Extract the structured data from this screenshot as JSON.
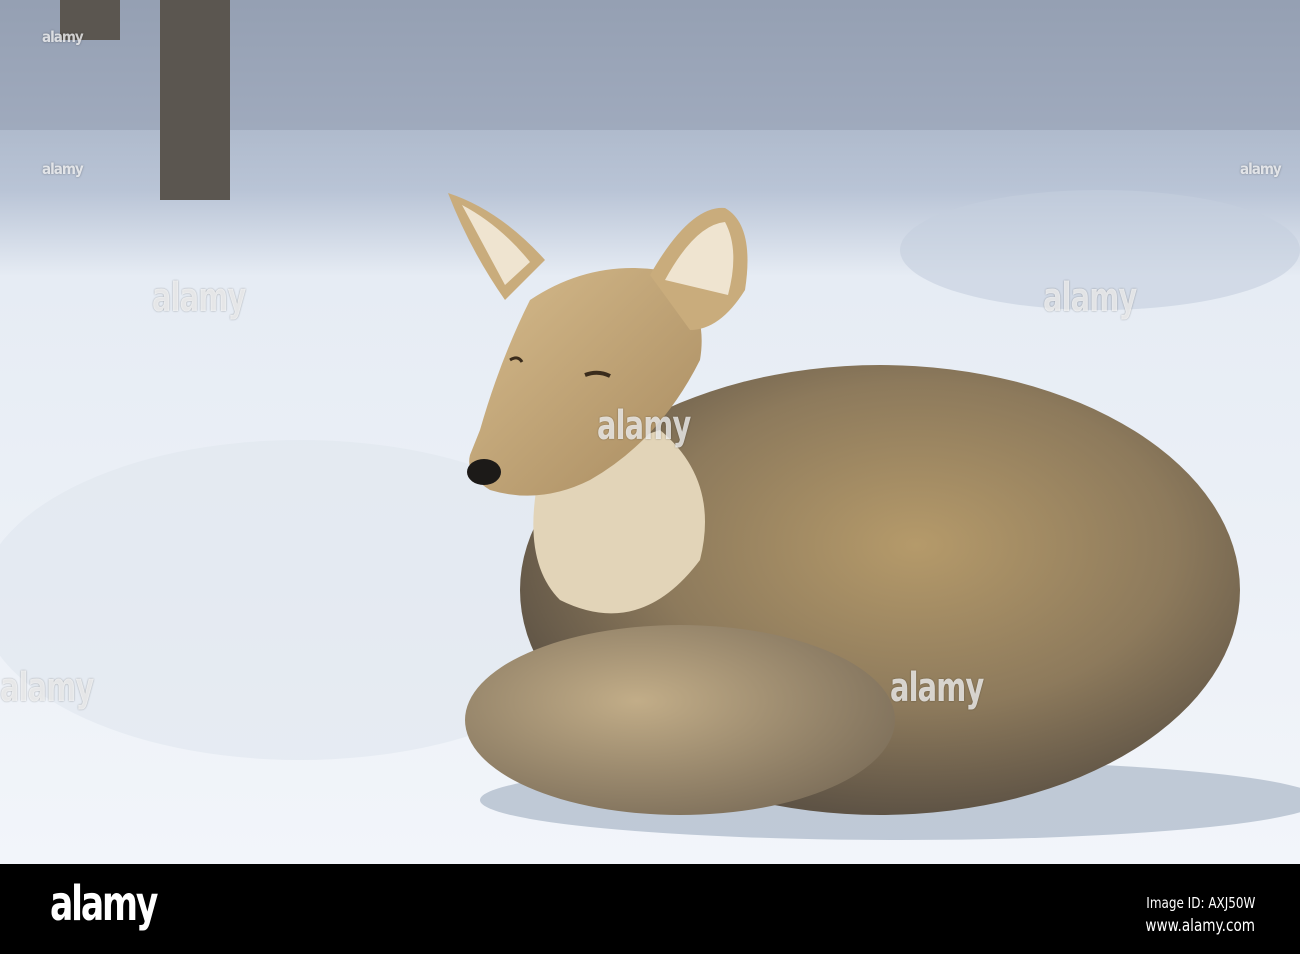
{
  "watermark": {
    "text": "alamy"
  },
  "footer": {
    "logo": "alamy",
    "image_id": "Image ID: AXJ50W",
    "website": "www.alamy.com"
  }
}
